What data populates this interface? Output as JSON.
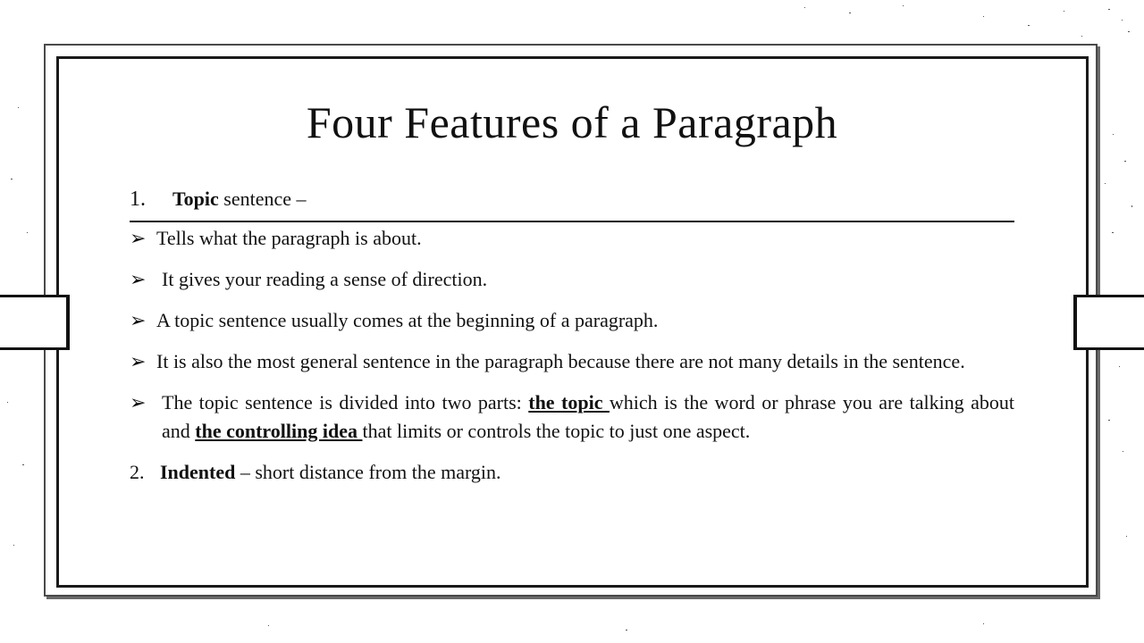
{
  "slide": {
    "title": "Four Features of a Paragraph",
    "item1": {
      "number": "1.",
      "bold": "Topic",
      "rest": " sentence –"
    },
    "bullets": [
      {
        "text": "Tells what the paragraph is about."
      },
      {
        "text": "It gives your reading a sense of direction."
      },
      {
        "text": "A topic sentence usually comes at the beginning of a paragraph."
      },
      {
        "text": "It is also the most general sentence in the paragraph because there are not many details in the sentence."
      }
    ],
    "bullet5": {
      "before": "The topic sentence is divided into two parts: ",
      "term1": "the topic ",
      "middle": "which is the word or phrase you are talking about and ",
      "term2": "the controlling idea ",
      "after": "that limits or controls the topic to just one aspect."
    },
    "item2": {
      "number": "2.",
      "bold": "Indented",
      "rest": " – short distance from the margin."
    },
    "bullet_glyph": "➢"
  }
}
